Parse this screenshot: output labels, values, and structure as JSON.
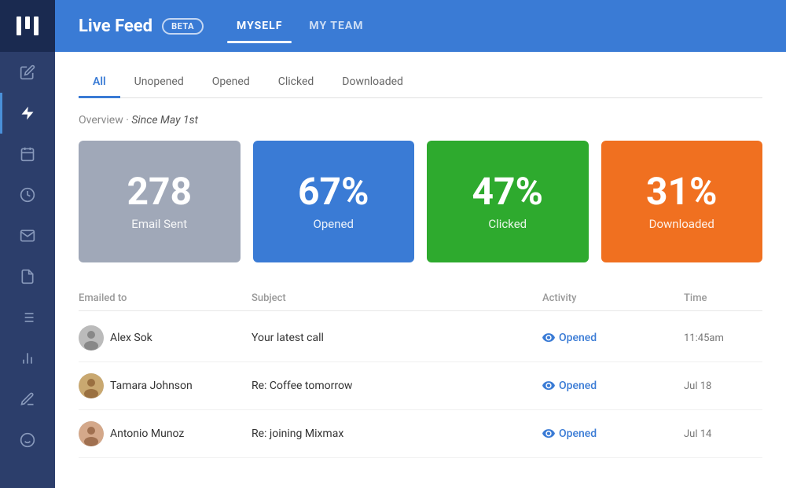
{
  "sidebar": {
    "logo_label": "MM",
    "items": [
      {
        "name": "edit-icon",
        "icon": "✎",
        "active": false
      },
      {
        "name": "lightning-icon",
        "icon": "⚡",
        "active": true
      },
      {
        "name": "calendar-icon",
        "icon": "📅",
        "active": false
      },
      {
        "name": "clock-icon",
        "icon": "⏰",
        "active": false
      },
      {
        "name": "mail-icon",
        "icon": "✉",
        "active": false
      },
      {
        "name": "document-icon",
        "icon": "📄",
        "active": false
      },
      {
        "name": "list-icon",
        "icon": "☰",
        "active": false
      },
      {
        "name": "chart-icon",
        "icon": "◑",
        "active": false
      },
      {
        "name": "pen-icon",
        "icon": "✏",
        "active": false
      },
      {
        "name": "emoji-icon",
        "icon": "☺",
        "active": false
      }
    ]
  },
  "topbar": {
    "title": "Live Feed",
    "beta": "BETA",
    "nav": [
      {
        "label": "MYSELF",
        "active": true
      },
      {
        "label": "MY TEAM",
        "active": false
      }
    ]
  },
  "filter_tabs": [
    {
      "label": "All",
      "active": true
    },
    {
      "label": "Unopened",
      "active": false
    },
    {
      "label": "Opened",
      "active": false
    },
    {
      "label": "Clicked",
      "active": false
    },
    {
      "label": "Downloaded",
      "active": false
    }
  ],
  "overview": {
    "label": "Overview",
    "since": "Since May 1st"
  },
  "stats": [
    {
      "value": "278",
      "label": "Email Sent",
      "color": "grey"
    },
    {
      "value": "67%",
      "label": "Opened",
      "color": "blue"
    },
    {
      "value": "47%",
      "label": "Clicked",
      "color": "green"
    },
    {
      "value": "31%",
      "label": "Downloaded",
      "color": "orange"
    }
  ],
  "table": {
    "headers": [
      "Emailed to",
      "Subject",
      "Activity",
      "Time"
    ],
    "rows": [
      {
        "name": "Alex Sok",
        "subject": "Your latest call",
        "activity": "Opened",
        "time": "11:45am"
      },
      {
        "name": "Tamara Johnson",
        "subject": "Re: Coffee tomorrow",
        "activity": "Opened",
        "time": "Jul 18"
      },
      {
        "name": "Antonio Munoz",
        "subject": "Re: joining Mixmax",
        "activity": "Opened",
        "time": "Jul 14"
      }
    ]
  },
  "colors": {
    "blue": "#3a7bd5",
    "green": "#2eaa2e",
    "orange": "#f07020",
    "grey": "#a0a8b8"
  }
}
